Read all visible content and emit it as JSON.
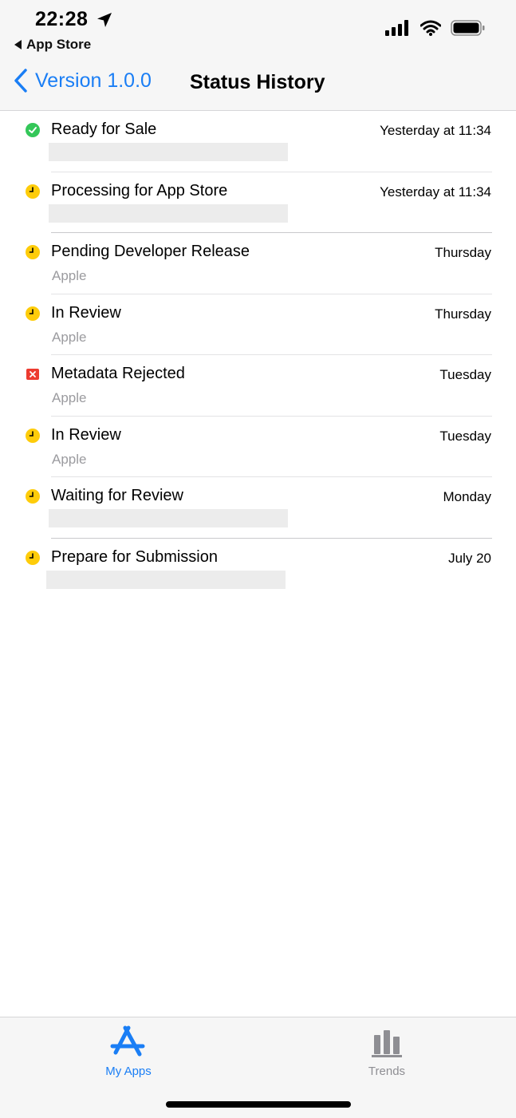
{
  "status_bar": {
    "time": "22:28",
    "back_app": "App Store"
  },
  "nav": {
    "back_label": "Version 1.0.0",
    "title": "Status History"
  },
  "colors": {
    "accent": "#1a7ef5",
    "green": "#34c759",
    "yellow": "#fecc0a",
    "red": "#ed3b30"
  },
  "history": [
    {
      "status": "Ready for Sale",
      "icon": "green-check-icon",
      "date": "Yesterday at 11:34",
      "sub": ""
    },
    {
      "status": "Processing for App Store",
      "icon": "yellow-clock-icon",
      "date": "Yesterday at 11:34",
      "sub": ""
    },
    {
      "status": "Pending Developer Release",
      "icon": "yellow-clock-icon",
      "date": "Thursday",
      "sub": "Apple"
    },
    {
      "status": "In Review",
      "icon": "yellow-clock-icon",
      "date": "Thursday",
      "sub": "Apple"
    },
    {
      "status": "Metadata Rejected",
      "icon": "red-x-icon",
      "date": "Tuesday",
      "sub": "Apple"
    },
    {
      "status": "In Review",
      "icon": "yellow-clock-icon",
      "date": "Tuesday",
      "sub": "Apple"
    },
    {
      "status": "Waiting for Review",
      "icon": "yellow-clock-icon",
      "date": "Monday",
      "sub": ""
    },
    {
      "status": "Prepare for Submission",
      "icon": "yellow-clock-icon",
      "date": "July 20",
      "sub": ""
    }
  ],
  "tabs": {
    "my_apps": "My Apps",
    "trends": "Trends"
  }
}
